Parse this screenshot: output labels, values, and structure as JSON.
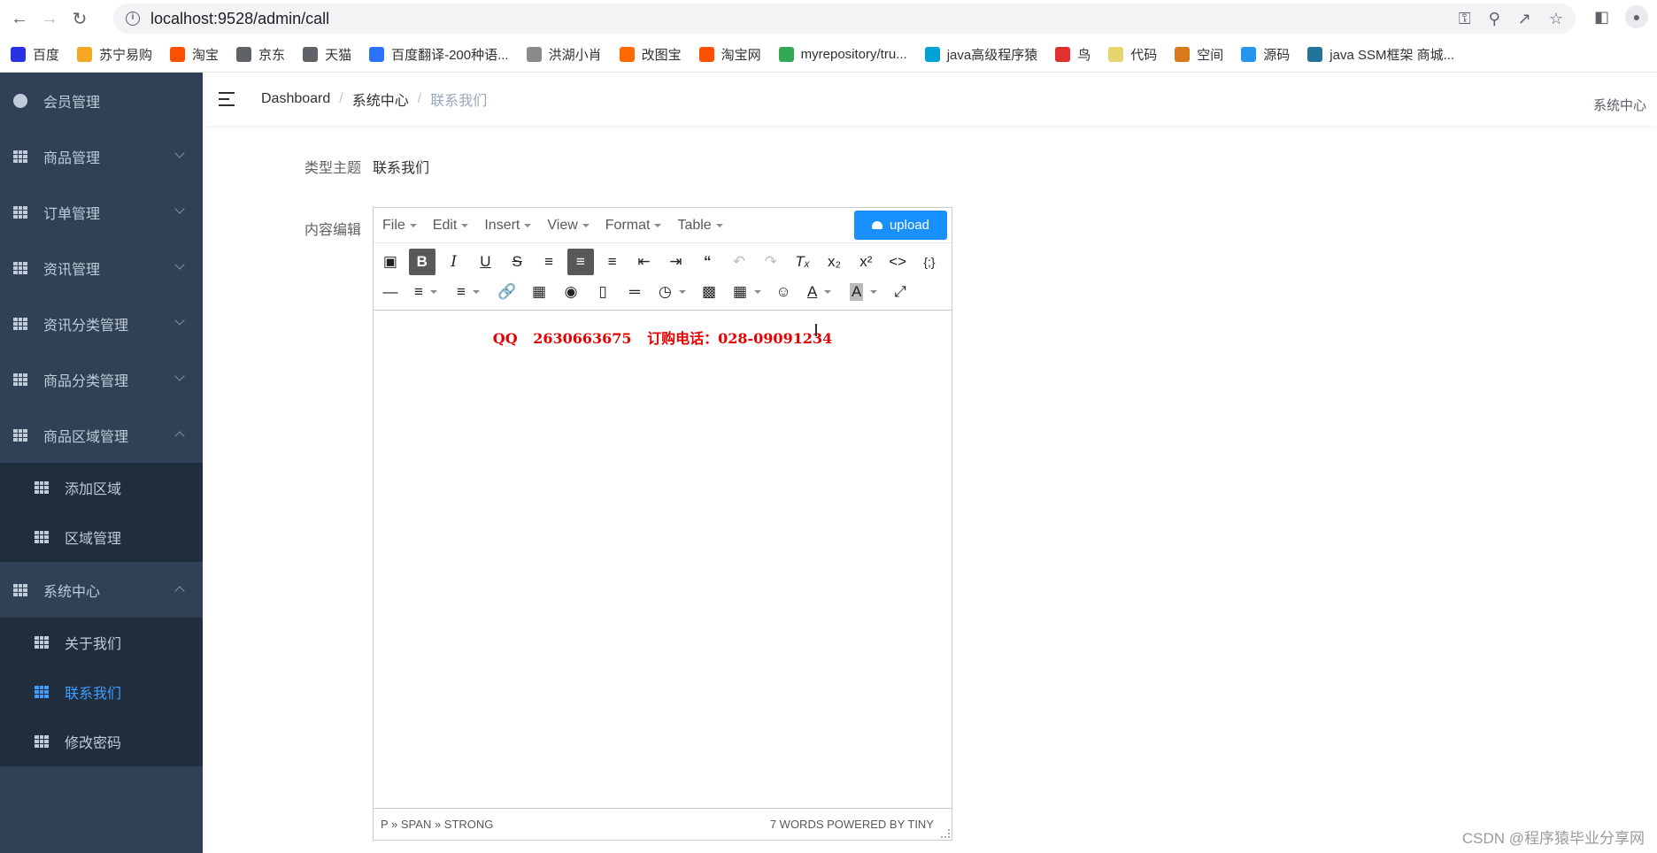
{
  "browser": {
    "url": "localhost:9528/admin/call",
    "bookmarks": [
      {
        "label": "百度",
        "color": "#2932e1"
      },
      {
        "label": "苏宁易购",
        "color": "#f5a623"
      },
      {
        "label": "淘宝",
        "color": "#ff5000"
      },
      {
        "label": "京东",
        "color": "#5f6368"
      },
      {
        "label": "天猫",
        "color": "#5f6368"
      },
      {
        "label": "百度翻译-200种语...",
        "color": "#2b73ff"
      },
      {
        "label": "洪湖小肖",
        "color": "#8a8a8a"
      },
      {
        "label": "改图宝",
        "color": "#ff6a00"
      },
      {
        "label": "淘宝网",
        "color": "#ff5000"
      },
      {
        "label": "myrepository/tru...",
        "color": "#34a853"
      },
      {
        "label": "java高级程序猿",
        "color": "#00a1d6"
      },
      {
        "label": "鸟",
        "color": "#e03030"
      },
      {
        "label": "代码",
        "color": "#e6d670"
      },
      {
        "label": "空间",
        "color": "#d97a1a"
      },
      {
        "label": "源码",
        "color": "#2496ed"
      },
      {
        "label": "java SSM框架 商城...",
        "color": "#21759b"
      }
    ]
  },
  "sidebar": {
    "items": [
      {
        "label": "会员管理"
      },
      {
        "label": "商品管理"
      },
      {
        "label": "订单管理"
      },
      {
        "label": "资讯管理"
      },
      {
        "label": "资讯分类管理"
      },
      {
        "label": "商品分类管理"
      },
      {
        "label": "商品区域管理"
      },
      {
        "label": "添加区域"
      },
      {
        "label": "区域管理"
      },
      {
        "label": "系统中心"
      },
      {
        "label": "关于我们"
      },
      {
        "label": "联系我们"
      },
      {
        "label": "修改密码"
      }
    ]
  },
  "navbar": {
    "breadcrumb": [
      "Dashboard",
      "系统中心",
      "联系我们"
    ],
    "right_text": "系统中心"
  },
  "form": {
    "type_label": "类型主题",
    "type_value": "联系我们",
    "content_label": "内容编辑"
  },
  "editor": {
    "menus": [
      "File",
      "Edit",
      "Insert",
      "View",
      "Format",
      "Table"
    ],
    "upload_label": "upload",
    "content": {
      "qq_label": "QQ",
      "qq_number": "2630663675",
      "phone_label": "订购电话：",
      "phone_number": "028-09091234"
    },
    "path": "P » SPAN » STRONG",
    "word_count": "7 WORDS POWERED BY TINY"
  },
  "watermark": "CSDN @程序猿毕业分享网",
  "colors": {
    "sidebar_bg": "#304156",
    "submenu_bg": "#1f2d3d",
    "active": "#409eff",
    "upload_btn": "#1890ff",
    "content_text": "#e60000"
  }
}
